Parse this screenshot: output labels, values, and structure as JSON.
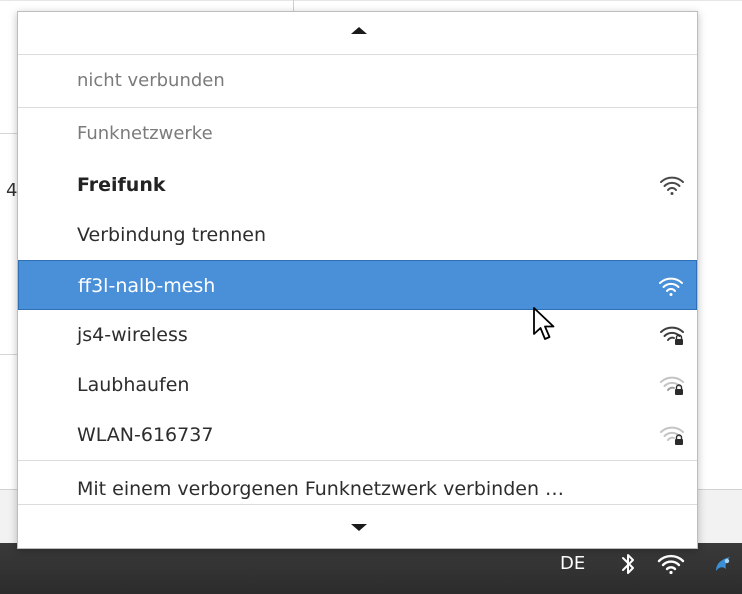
{
  "menu": {
    "status": "nicht verbunden",
    "section_header": "Funknetzwerke",
    "connected_network": "Freifunk",
    "disconnect_label": "Verbindung trennen",
    "networks": [
      {
        "name": "ff3l-nalb-mesh",
        "secured": false,
        "strength": "full",
        "selected": true
      },
      {
        "name": "js4-wireless",
        "secured": true,
        "strength": "full",
        "selected": false
      },
      {
        "name": "Laubhaufen",
        "secured": true,
        "strength": "weak",
        "selected": false
      },
      {
        "name": "WLAN-616737",
        "secured": true,
        "strength": "weak",
        "selected": false
      }
    ],
    "hidden_network_label": "Mit einem verborgenen Funknetzwerk verbinden …",
    "scroll_up_icon": "triangle-up-icon",
    "scroll_down_icon": "triangle-down-icon"
  },
  "background": {
    "fragment_digit": "4"
  },
  "taskbar": {
    "keyboard_layout": "DE",
    "bluetooth_icon": "bluetooth-icon",
    "wifi_icon": "wifi-icon",
    "app_icon": "app-icon"
  },
  "colors": {
    "highlight": "#4a90d9",
    "taskbar": "#2c2c2c",
    "text": "#2d2d2d",
    "muted_text": "#7b7b7b"
  }
}
